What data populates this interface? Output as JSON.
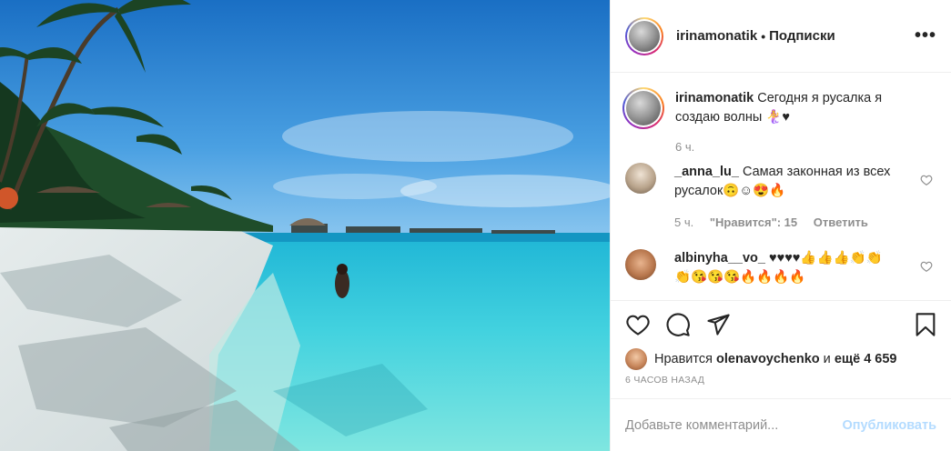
{
  "post": {
    "author": "irinamonatik",
    "separator": "•",
    "follow_label": "Подписки",
    "more_label": "•••"
  },
  "caption": {
    "user": "irinamonatik",
    "text": "Сегодня я русалка я создаю волны 🧜‍♀️♥",
    "time": "6 ч."
  },
  "comments": [
    {
      "user": "_anna_lu_",
      "text": "Самая законная из всех русалок🙃☺😍🔥",
      "time": "5 ч.",
      "likes": "\"Нравится\": 15",
      "reply": "Ответить"
    },
    {
      "user": "albinyha__vo_",
      "text": "♥♥♥♥👍👍👍👏👏👏😘😘😘🔥🔥🔥🔥"
    }
  ],
  "likes_line": {
    "prefix": "Нравится",
    "user": "olenavoychenko",
    "mid": "и",
    "count": "ещё 4 659"
  },
  "time_ago": "6 ЧАСОВ НАЗАД",
  "add_comment": {
    "placeholder": "Добавьте комментарий...",
    "publish": "Опубликовать"
  },
  "icons": {
    "like": "heart-icon",
    "comment": "comment-icon",
    "share": "share-icon",
    "save": "bookmark-icon",
    "more": "more-icon"
  },
  "colors": {
    "accent_disabled": "#b3dbff",
    "text": "#262626",
    "muted": "#8e8e8e"
  }
}
